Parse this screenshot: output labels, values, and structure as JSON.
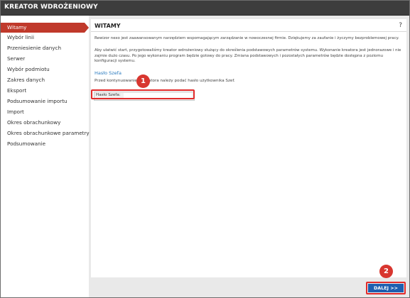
{
  "window": {
    "title": "KREATOR WDROŻENIOWY"
  },
  "sidebar": {
    "items": [
      {
        "label": "Witamy",
        "active": true
      },
      {
        "label": "Wybór linii"
      },
      {
        "label": "Przeniesienie danych"
      },
      {
        "label": "Serwer"
      },
      {
        "label": "Wybór podmiotu"
      },
      {
        "label": "Zakres danych"
      },
      {
        "label": "Eksport"
      },
      {
        "label": "Podsumowanie importu"
      },
      {
        "label": "Import"
      },
      {
        "label": "Okres obrachunkowy"
      },
      {
        "label": "Okres obrachunkowe parametry"
      },
      {
        "label": "Podsumowanie"
      }
    ]
  },
  "content": {
    "heading": "WITAMY",
    "help": "?",
    "para1": "Rewizor nexo jest zaawansowanym narzędziem wspomagającym zarządzanie w nowoczesnej firmie. Dziękujemy za zaufanie i życzymy bezproblemowej pracy.",
    "para2": "Aby ułatwić start, przygotowaliśmy kreator wdrożeniowy służący do określenia podstawowych parametrów systemu. Wykonanie kreatora jest jednorazowe i nie zajmie dużo czasu. Po jego wykonaniu program będzie gotowy do pracy. Zmiana podstawowych i pozostałych parametrów będzie dostępna z poziomu konfiguracji systemu.",
    "link": "Hasło Szefa",
    "instruction": "Przed kontynuowaniem kreatora należy podać hasło użytkownika Szef.",
    "field_label": "Hasło Szefa:",
    "field_value": ""
  },
  "annotations": {
    "badge1": "1",
    "badge2": "2"
  },
  "footer": {
    "next_label": "DALEJ >>"
  },
  "colors": {
    "accent": "#c0392b",
    "primary_button": "#1e5fb0",
    "highlight": "#e12b2b",
    "link": "#2b7bbf"
  }
}
